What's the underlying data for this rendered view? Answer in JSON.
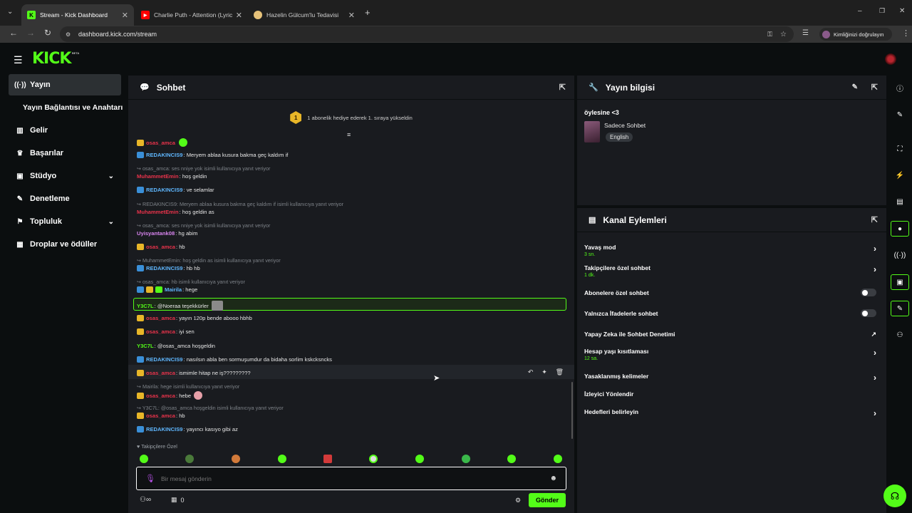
{
  "browser": {
    "tabs": [
      {
        "title": "Stream - Kick Dashboard",
        "icon": "kick-favicon"
      },
      {
        "title": "Charlie Puth - Attention (Lyrics)",
        "icon": "youtube-favicon"
      },
      {
        "title": "Hazelin Gülcum'lu Tedavisi",
        "icon": "site-favicon"
      }
    ],
    "url": "dashboard.kick.com/stream",
    "profile_label": "Kimliğinizi doğrulayın"
  },
  "site": {
    "logo": "KICK",
    "logo_badge": "BETA"
  },
  "nav": {
    "items": [
      {
        "label": "Yayın",
        "icon": "stream-icon"
      },
      {
        "label": "Yayın Bağlantısı ve Anahtarı",
        "icon": ""
      },
      {
        "label": "Gelir",
        "icon": "chart-icon"
      },
      {
        "label": "Başarılar",
        "icon": "trophy-icon"
      },
      {
        "label": "Stüdyo",
        "icon": "studio-icon"
      },
      {
        "label": "Denetleme",
        "icon": "wrench-icon"
      },
      {
        "label": "Topluluk",
        "icon": "community-icon"
      },
      {
        "label": "Droplar ve ödüller",
        "icon": "gift-icon"
      }
    ]
  },
  "chat": {
    "title": "Sohbet",
    "pinned_notice": "1 abonelik hediye ederek 1. sıraya yükseldin",
    "pinned_rank": "1",
    "messages": [
      {
        "user": "osas_amca",
        "color": "#e9334b",
        "text": "",
        "badges": [
          "crown"
        ],
        "emote": true
      },
      {
        "user": "REDAKINCIS9",
        "color": "#5fb7ff",
        "text": ": Meryem ablaa kusura bakma geç kaldım if",
        "badges": [
          "blue"
        ]
      },
      {
        "reply": "osas_amca: ses nniye yok isimli kullanıcıya yanıt veriyor",
        "user": "MuhammetEmin",
        "color": "#e9334b",
        "text": ": hoş geldin"
      },
      {
        "user": "REDAKINCIS9",
        "color": "#5fb7ff",
        "text": ": ve selamlar",
        "badges": [
          "blue"
        ]
      },
      {
        "reply": "REDAKINCIS9: Meryem ablaa kusura bakma geç kaldım if isimli kullanıcıya yanıt veriyor",
        "user": "MuhammetEmin",
        "color": "#e9334b",
        "text": ": hoş geldin as"
      },
      {
        "reply": "osas_amca: ses nniye yok isimli kullanıcıya yanıt veriyor",
        "user": "Uyisyantank08",
        "color": "#d985f0",
        "text": ": hg abim"
      },
      {
        "user": "osas_amca",
        "color": "#e9334b",
        "text": ": hb",
        "badges": [
          "crown"
        ]
      },
      {
        "reply": "MuhammetEmin: hoş geldin as isimli kullanıcıya yanıt veriyor",
        "user": "REDAKINCIS9",
        "color": "#5fb7ff",
        "text": ": hb hb",
        "badges": [
          "blue"
        ]
      },
      {
        "reply": "osas_amca: hb isimli kullanıcıya yanıt veriyor",
        "user": "Mairila",
        "color": "#5fb7ff",
        "text": ": hege",
        "badges": [
          "blue",
          "crown",
          "green"
        ]
      },
      {
        "user": "Y3C7L",
        "color": "#53fc18",
        "text": ": @Noeraa teşekkürler",
        "highlight": true
      },
      {
        "user": "osas_amca",
        "color": "#e9334b",
        "text": ": yayın 120p bende abooo hbhb",
        "badges": [
          "crown"
        ]
      },
      {
        "user": "osas_amca",
        "color": "#e9334b",
        "text": ": iyi sen",
        "badges": [
          "crown"
        ]
      },
      {
        "user": "Y3C7L",
        "color": "#53fc18",
        "text": ": @osas_amca hoşgeldin"
      },
      {
        "user": "REDAKINCIS9",
        "color": "#5fb7ff",
        "text": ": nasılsın abla ben sormuşumdur da bidaha sorlim kskcksncks",
        "badges": [
          "blue"
        ]
      },
      {
        "user": "osas_amca",
        "color": "#e9334b",
        "text": ": ismimle hitap ne iş?????????",
        "badges": [
          "crown"
        ]
      },
      {
        "reply": "Mairila: hege isimli kullanıcıya yanıt veriyor",
        "user": "osas_amca",
        "color": "#e9334b",
        "text": ": hebe",
        "badges": [
          "crown"
        ]
      },
      {
        "reply": "Y3C7L: @osas_amca hoşgeldin isimli kullanıcıya yanıt veriyor",
        "user": "osas_amca",
        "color": "#e9334b",
        "text": ": hb",
        "badges": [
          "crown"
        ]
      },
      {
        "user": "REDAKINCIS9",
        "color": "#5fb7ff",
        "text": ": yayıncı kasıyo gibi az",
        "badges": [
          "blue"
        ]
      }
    ],
    "followers_only_label": "Takipçilere Özel",
    "input_placeholder": "Bir mesaj gönderin",
    "send_label": "Gönder",
    "viewer_count": "0"
  },
  "stream_info": {
    "title": "Yayın bilgisi",
    "stream_title": "öylesine <3",
    "category": "Sadece Sohbet",
    "language_tag": "English"
  },
  "channel_actions": {
    "title": "Kanal Eylemleri",
    "items": [
      {
        "label": "Yavaş mod",
        "sub": "3 sn.",
        "control": "arrow"
      },
      {
        "label": "Takipçilere özel sohbet",
        "sub": "1 dk.",
        "control": "arrow"
      },
      {
        "label": "Abonelere özel sohbet",
        "sub": "",
        "control": "toggle"
      },
      {
        "label": "Yalnızca İfadelerle sohbet",
        "sub": "",
        "control": "toggle"
      },
      {
        "label": "Yapay Zeka ile Sohbet Denetimi",
        "sub": "",
        "control": "external"
      },
      {
        "label": "Hesap yaşı kısıtlaması",
        "sub": "12 sa.",
        "control": "arrow"
      },
      {
        "label": "Yasaklanmış kelimeler",
        "sub": "",
        "control": "arrow"
      },
      {
        "label": "İzleyici Yönlendir",
        "sub": "",
        "control": "none"
      },
      {
        "label": "Hedefleri belirleyin",
        "sub": "",
        "control": "arrow"
      }
    ]
  },
  "colors": {
    "accent": "#53fc18",
    "panel": "#191b1f",
    "bg": "#0b0e0f"
  }
}
